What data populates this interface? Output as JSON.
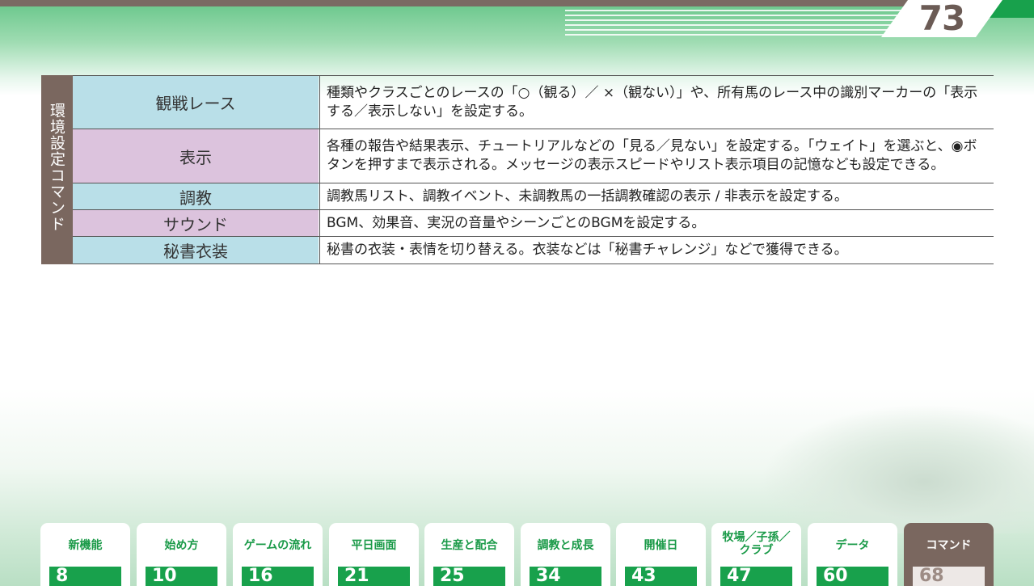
{
  "page_number": "73",
  "side_header": "環境設定コマンド",
  "rows": [
    {
      "label": "観戦レース",
      "desc": "種類やクラスごとのレースの「○（観る）／ ×（観ない）」や、所有馬のレース中の識別マーカーの「表示する／表示しない」を設定する。"
    },
    {
      "label": "表示",
      "desc": "各種の報告や結果表示、チュートリアルなどの「見る／見ない」を設定する。「ウェイト」を選ぶと、◉ボタンを押すまで表示される。メッセージの表示スピードやリスト表示項目の記憶なども設定できる。"
    },
    {
      "label": "調教",
      "desc": "調教馬リスト、調教イベント、未調教馬の一括調教確認の表示 / 非表示を設定する。"
    },
    {
      "label": "サウンド",
      "desc": "BGM、効果音、実況の音量やシーンごとのBGMを設定する。"
    },
    {
      "label": "秘書衣装",
      "desc": "秘書の衣装・表情を切り替える。衣装などは「秘書チャレンジ」などで獲得できる。"
    }
  ],
  "nav": [
    {
      "label": "新機能",
      "num": "8"
    },
    {
      "label": "始め方",
      "num": "10"
    },
    {
      "label": "ゲームの流れ",
      "num": "16"
    },
    {
      "label": "平日画面",
      "num": "21"
    },
    {
      "label": "生産と配合",
      "num": "25"
    },
    {
      "label": "調教と成長",
      "num": "34"
    },
    {
      "label": "開催日",
      "num": "43"
    },
    {
      "label": "牧場／子孫／クラブ",
      "num": "47"
    },
    {
      "label": "データ",
      "num": "60"
    },
    {
      "label": "コマンド",
      "num": "68"
    }
  ],
  "colors": {
    "brown": "#7a675f",
    "green": "#18a14c",
    "row_blue": "#b9dfe8",
    "row_pink": "#dcc3dd"
  }
}
